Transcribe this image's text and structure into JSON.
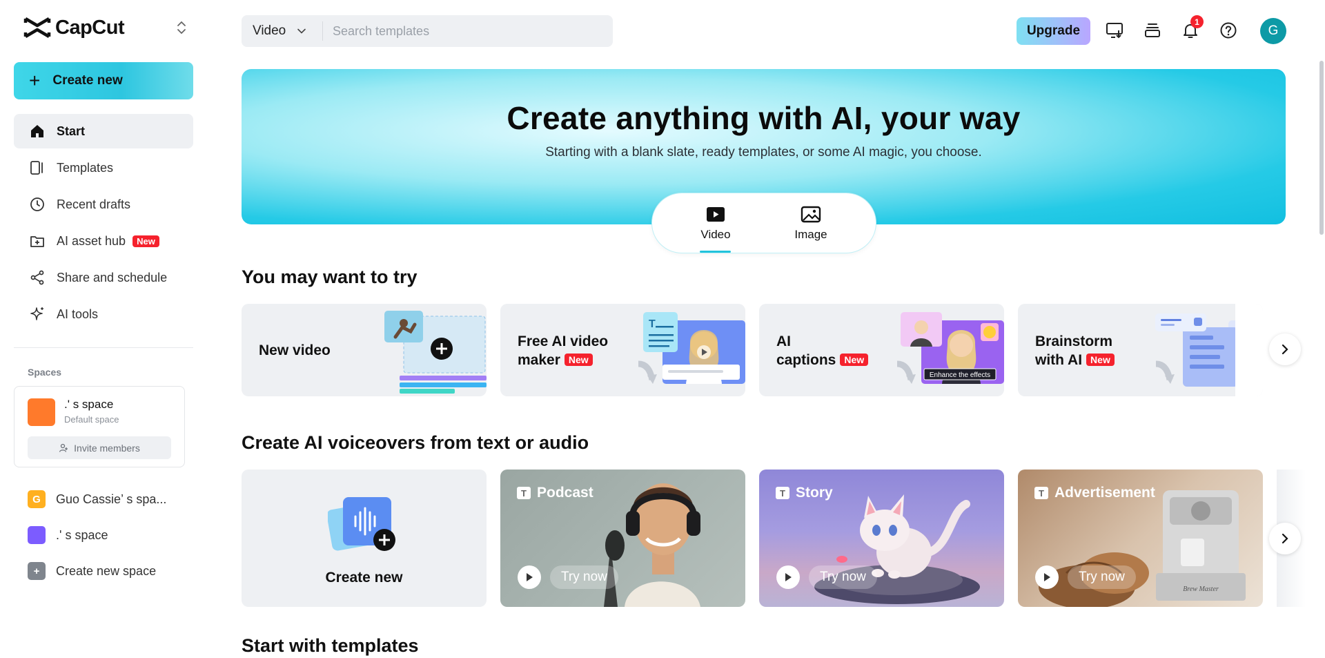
{
  "app": {
    "name": "CapCut"
  },
  "sidebar": {
    "create_label": "Create new",
    "nav": [
      {
        "label": "Start",
        "icon": "home-icon",
        "active": true
      },
      {
        "label": "Templates",
        "icon": "templates-icon"
      },
      {
        "label": "Recent drafts",
        "icon": "clock-icon"
      },
      {
        "label": "AI asset hub",
        "icon": "asset-hub-icon",
        "badge": "New"
      },
      {
        "label": "Share and schedule",
        "icon": "share-icon"
      },
      {
        "label": "AI tools",
        "icon": "sparkle-icon"
      }
    ],
    "spaces_title": "Spaces",
    "current_space": {
      "name": ".' s space",
      "subtitle": "Default space",
      "invite_label": "Invite members",
      "color": "#ff7a2b"
    },
    "space_list": [
      {
        "label": "Guo Cassie’ s spa...",
        "initial": "G",
        "color": "#ffb020"
      },
      {
        "label": ".' s space",
        "initial": "",
        "color": "#7c5cff"
      },
      {
        "label": "Create new space",
        "initial": "+",
        "color": "#7f858d"
      }
    ]
  },
  "topbar": {
    "search_type": "Video",
    "search_placeholder": "Search templates",
    "upgrade_label": "Upgrade",
    "notification_count": "1",
    "avatar_initial": "G"
  },
  "hero": {
    "title": "Create anything with AI, your way",
    "subtitle": "Starting with a blank slate, ready templates, or some AI magic, you choose.",
    "tabs": [
      {
        "label": "Video",
        "active": true
      },
      {
        "label": "Image"
      }
    ]
  },
  "try_section": {
    "title": "You may want to try",
    "cards": [
      {
        "line1": "New video",
        "line2": "",
        "badge": ""
      },
      {
        "line1": "Free AI video",
        "line2": "maker",
        "badge": "New"
      },
      {
        "line1": "AI",
        "line2": "captions",
        "badge": "New",
        "overlay_text": "Enhance the effects"
      },
      {
        "line1": "Brainstorm",
        "line2": "with AI",
        "badge": "New"
      }
    ]
  },
  "voice_section": {
    "title": "Create AI voiceovers from text or audio",
    "create_label": "Create new",
    "cards": [
      {
        "label": "Podcast",
        "try_label": "Try now"
      },
      {
        "label": "Story",
        "try_label": "Try now"
      },
      {
        "label": "Advertisement",
        "try_label": "Try now",
        "machine_text": "Brew Master"
      }
    ]
  },
  "templates_section": {
    "title": "Start with templates"
  },
  "colors": {
    "accent": "#22c3dc",
    "badge": "#f5222d",
    "card_bg": "#eef0f3"
  }
}
